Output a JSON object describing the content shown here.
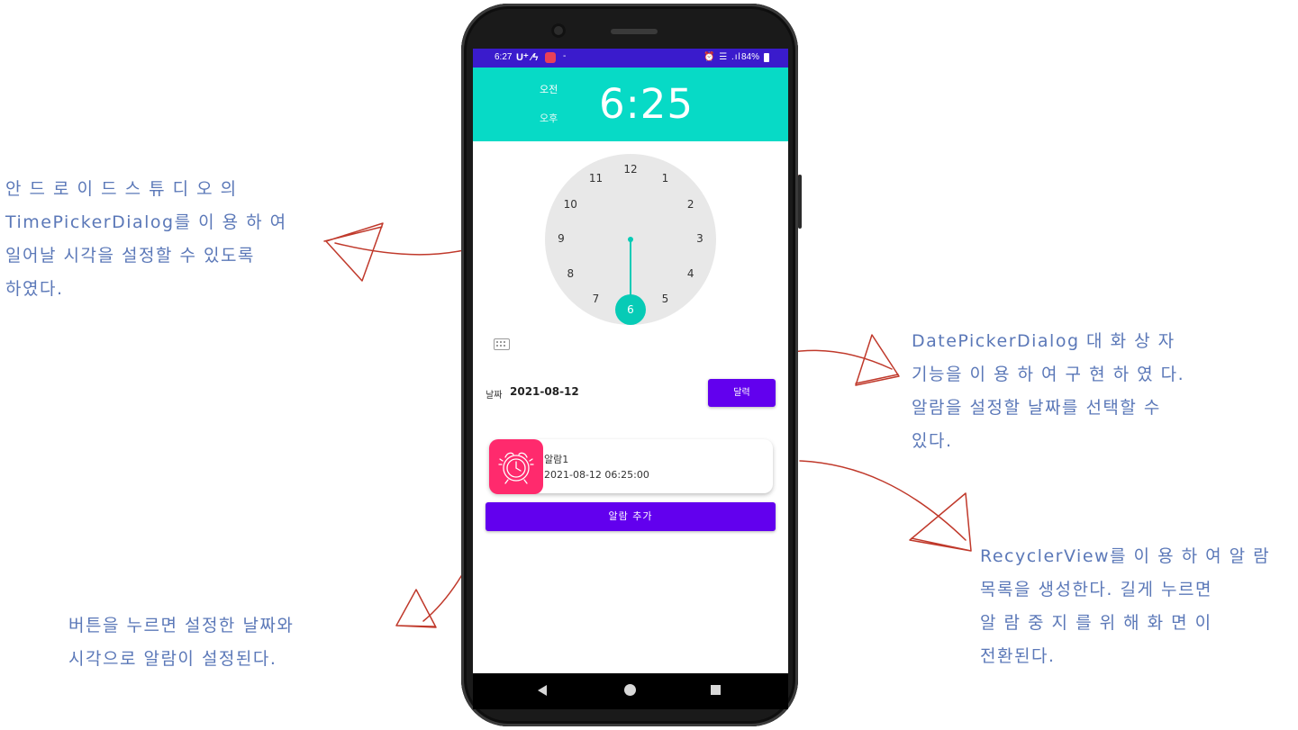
{
  "annotations": {
    "left": [
      "안 드 로 이 드  스 튜 디 오 의",
      "TimePickerDialog를  이 용 하 여",
      "일어날 시각을 설정할 수 있도록",
      "하였다."
    ],
    "right_top": [
      "DatePickerDialog  대 화 상 자",
      "기능을  이 용 하 여  구 현 하 였 다.",
      "알람을 설정할 날짜를 선택할 수",
      "있다."
    ],
    "right_bottom": [
      "RecyclerView를  이 용 하 여  알 람",
      "목록을 생성한다. 길게 누르면",
      "알 람  중 지 를  위 해  화 면 이",
      "전환된다."
    ],
    "bottom_left": [
      "버튼을 누르면 설정한 날짜와",
      "시각으로 알람이 설정된다."
    ]
  },
  "statusbar": {
    "time": "6:27",
    "carrier": "U⁺ ⁄ϟ",
    "dash": "-",
    "icons": "⏰ ☰ .ıl",
    "battery": "84%"
  },
  "time_picker": {
    "am_label": "오전",
    "pm_label": "오후",
    "time": "6:25",
    "clock_numbers": [
      "12",
      "1",
      "2",
      "3",
      "4",
      "5",
      "6",
      "7",
      "8",
      "9",
      "10",
      "11"
    ],
    "selected": "6"
  },
  "date": {
    "label": "날짜",
    "value": "2021-08-12",
    "calendar_button": "달력"
  },
  "alarm_list": [
    {
      "title": "알람1",
      "datetime": "2021-08-12 06:25:00"
    }
  ],
  "add_button": "알람 추가",
  "colors": {
    "status_bar": "#3a1bcc",
    "header": "#07dac6",
    "accent": "#6200ee",
    "alarm_icon_bg": "#ff2a6d",
    "annotation_text": "#5b78b8",
    "arrow": "#c0392b"
  }
}
